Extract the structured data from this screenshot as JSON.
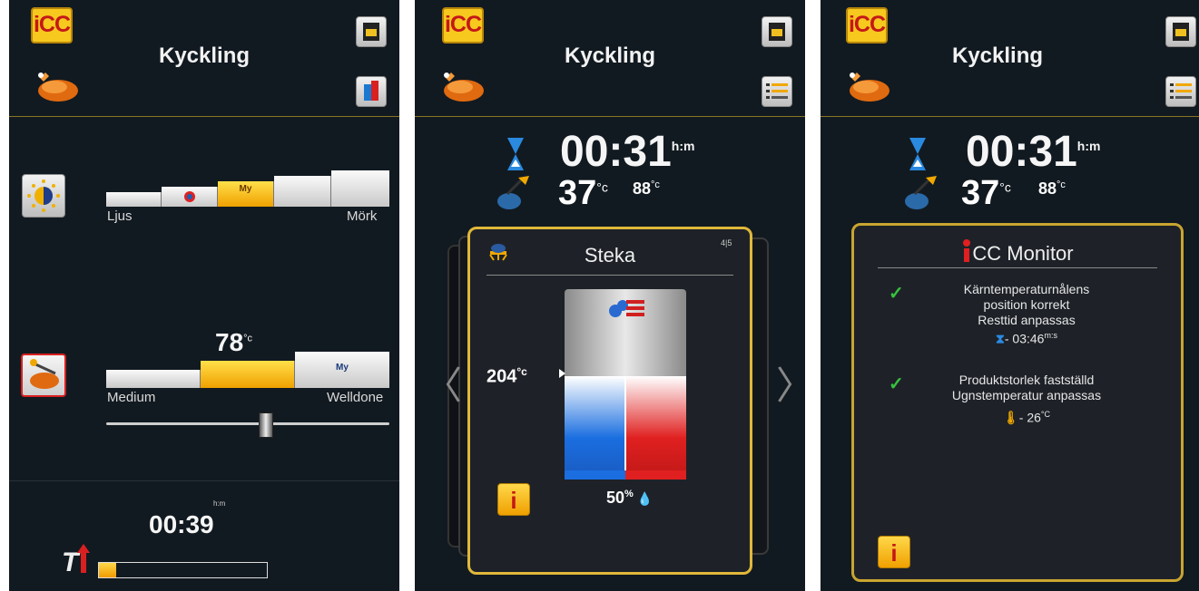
{
  "screens": [
    {
      "title": "Kyckling",
      "logo": "iCC",
      "browning": {
        "left_label": "Ljus",
        "right_label": "Mörk",
        "my_label": "My"
      },
      "doneness": {
        "value": "78",
        "unit": "°c",
        "left_label": "Medium",
        "right_label": "Welldone",
        "my_label": "My"
      },
      "time": {
        "unit": "h:m",
        "value": "00:39",
        "progress": 0.1
      }
    },
    {
      "title": "Kyckling",
      "logo": "iCC",
      "time": {
        "value": "00:31",
        "unit": "h:m"
      },
      "core_temp": {
        "value": "37",
        "unit": "°c"
      },
      "target_temp": {
        "value": "88",
        "unit": "°c"
      },
      "step": {
        "name": "Steka",
        "counter": "4|5",
        "temp": "204",
        "temp_unit": "°c",
        "humidity": "50",
        "humidity_unit": "%"
      }
    },
    {
      "title": "Kyckling",
      "logo": "iCC",
      "time": {
        "value": "00:31",
        "unit": "h:m"
      },
      "core_temp": {
        "value": "37",
        "unit": "°c"
      },
      "target_temp": {
        "value": "88",
        "unit": "°c"
      },
      "monitor": {
        "title_rest": "CC Monitor",
        "msg1": [
          "Kärntemperaturnålens",
          "position korrekt",
          "Resttid anpassas"
        ],
        "msg1_time": "- 03:46",
        "msg1_time_unit": "m:s",
        "msg2": [
          "Produktstorlek fastställd",
          "Ugnstemperatur anpassas"
        ],
        "msg2_temp": "- 26",
        "msg2_temp_unit": "°C"
      }
    }
  ],
  "colors": {
    "accent": "#f0a800",
    "background": "#121a21",
    "frame": "#e0b83a"
  }
}
